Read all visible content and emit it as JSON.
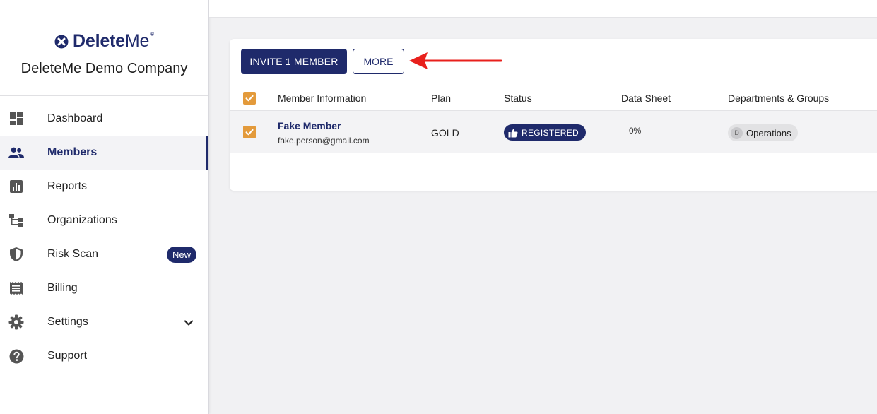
{
  "brand": {
    "logo_bold": "Delete",
    "logo_light": "Me",
    "logo_mark": "®",
    "company": "DeleteMe Demo Company"
  },
  "sidebar": {
    "items": [
      {
        "label": "Dashboard",
        "icon": "dashboard-icon"
      },
      {
        "label": "Members",
        "icon": "people-icon",
        "active": true
      },
      {
        "label": "Reports",
        "icon": "bar-chart-icon"
      },
      {
        "label": "Organizations",
        "icon": "hierarchy-icon"
      },
      {
        "label": "Risk Scan",
        "icon": "shield-icon",
        "badge": "New"
      },
      {
        "label": "Billing",
        "icon": "receipt-icon"
      },
      {
        "label": "Settings",
        "icon": "gear-icon"
      },
      {
        "label": "Support",
        "icon": "help-icon"
      }
    ]
  },
  "toolbar": {
    "invite_label": "INVITE 1 MEMBER",
    "more_label": "MORE"
  },
  "table": {
    "columns": [
      "Member Information",
      "Plan",
      "Status",
      "Data Sheet",
      "Departments & Groups"
    ],
    "rows": [
      {
        "name": "Fake Member",
        "email": "fake.person@gmail.com",
        "plan": "GOLD",
        "status": "REGISTERED",
        "data_sheet": "0%",
        "group_initial": "D",
        "group": "Operations"
      }
    ]
  },
  "colors": {
    "brand_navy": "#1f2a6b",
    "checkbox_orange": "#e39a3b",
    "annotation_red": "#e8201c"
  }
}
